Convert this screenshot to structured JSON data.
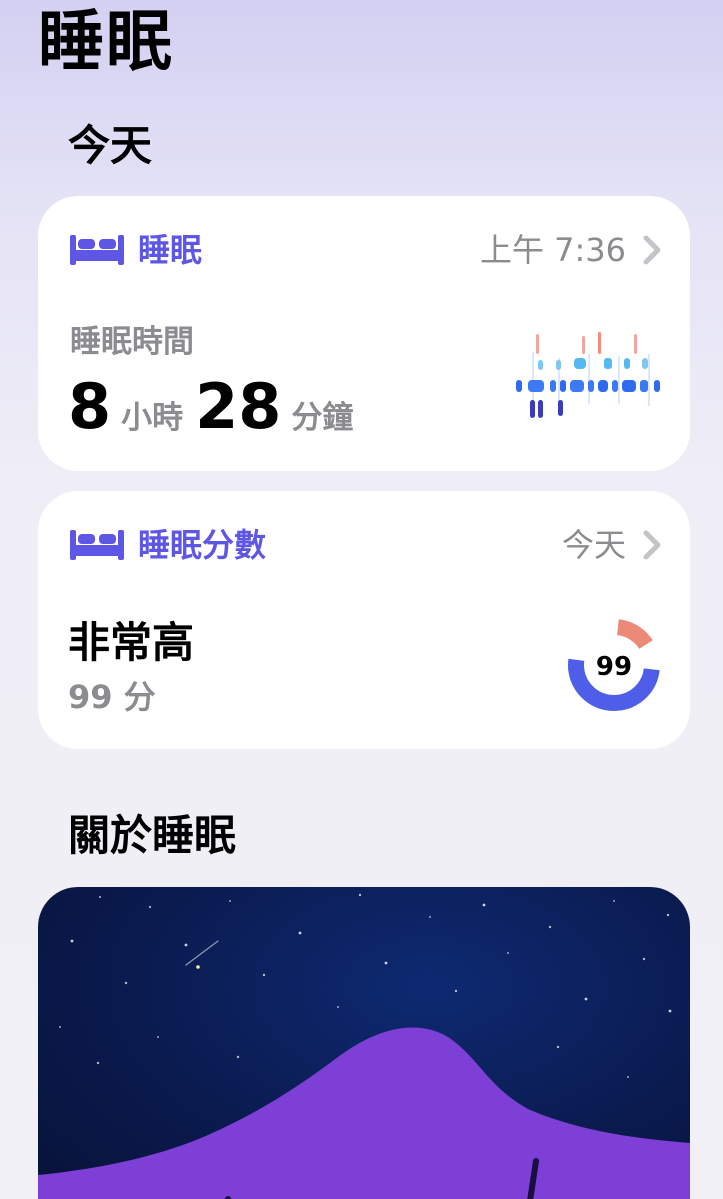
{
  "header": {
    "title": "睡眠"
  },
  "today": {
    "title": "今天"
  },
  "sleep_card": {
    "label": "睡眠",
    "time": "上午 7:36",
    "sub_label": "睡眠時間",
    "hours": "8",
    "hours_unit": "小時",
    "minutes": "28",
    "minutes_unit": "分鐘",
    "icon": "bed-icon",
    "accent": "#5e56e4"
  },
  "score_card": {
    "label": "睡眠分數",
    "period": "今天",
    "level": "非常高",
    "score_text": "99 分",
    "ring_value": "99",
    "icon": "bed-icon"
  },
  "about": {
    "title": "關於睡眠",
    "image": "night-sky-illustration"
  },
  "colors": {
    "accent": "#5e56e4",
    "secondary_text": "#8b8b90",
    "ring_green": "#5ccfbd",
    "ring_coral": "#ec8a78",
    "ring_blue": "#4f5ee8"
  }
}
